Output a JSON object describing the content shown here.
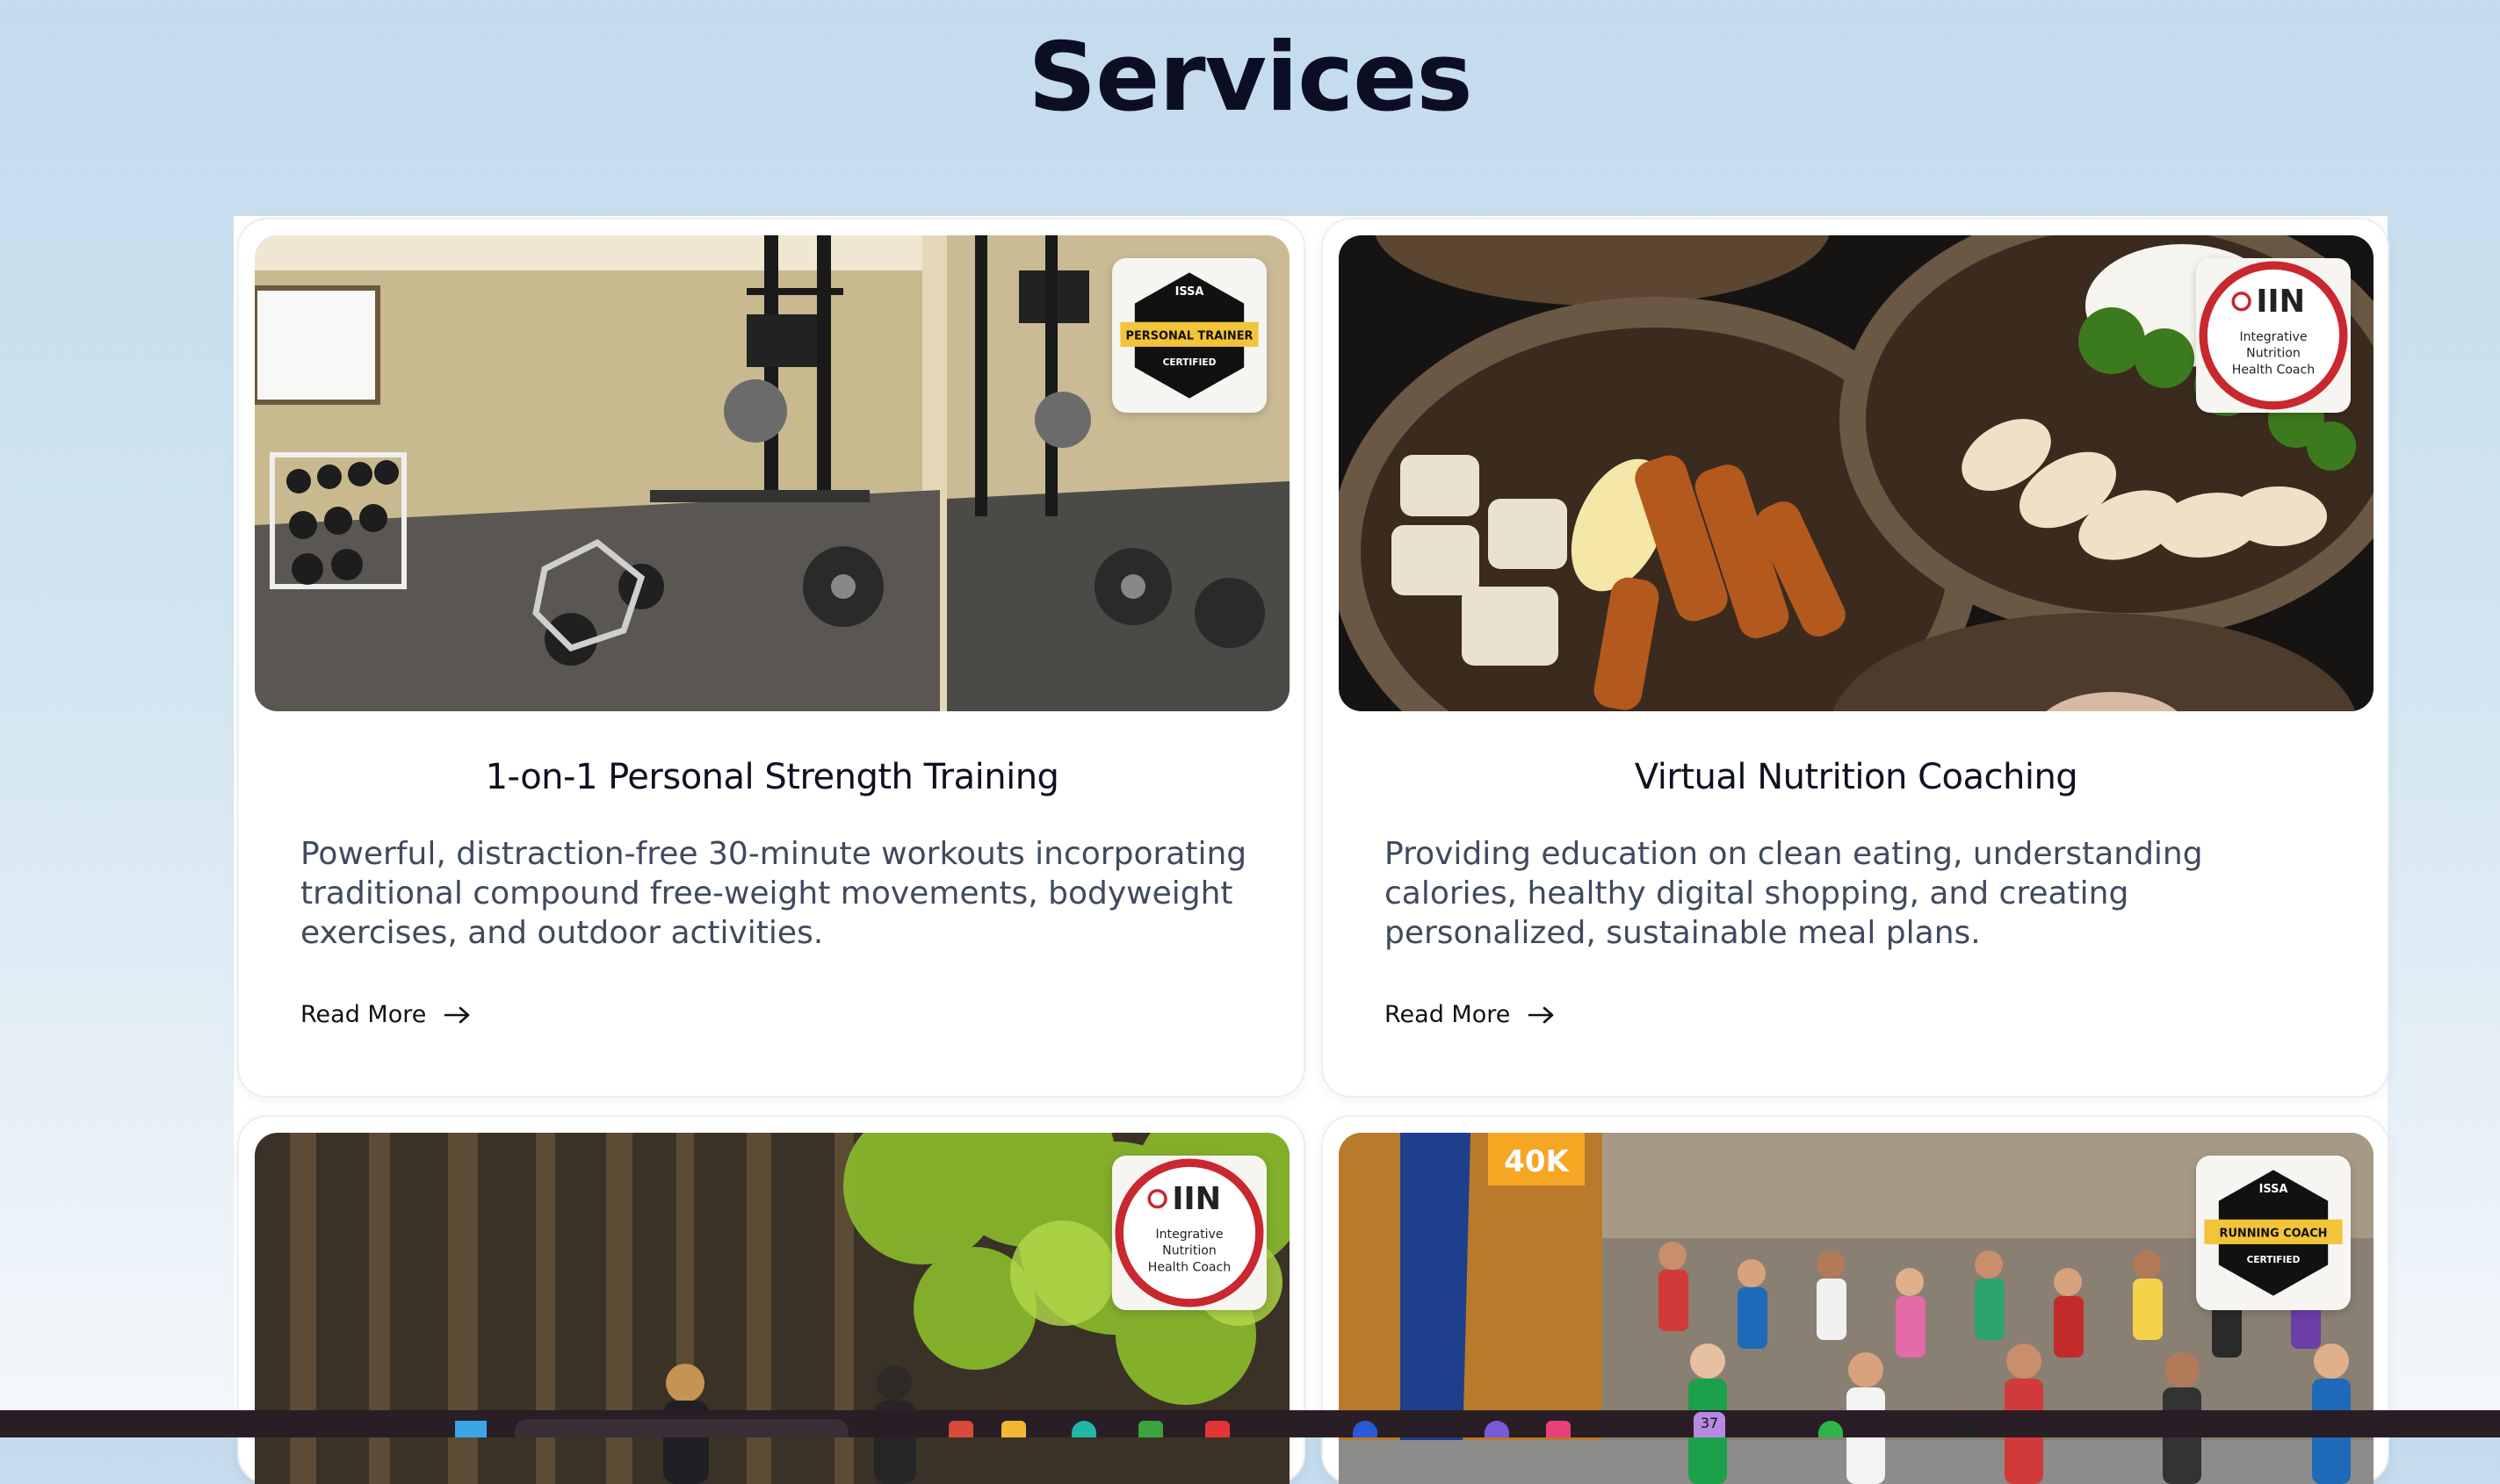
{
  "page": {
    "title": "Services"
  },
  "cards": [
    {
      "title": "1-on-1 Personal Strength Training",
      "description": "Powerful, distraction-free 30-minute workouts incorporating traditional compound free-weight movements, bodyweight exercises, and outdoor activities.",
      "read_more": "Read More",
      "image": "home-gym-photo",
      "badge": {
        "org": "ISSA",
        "label": "PERSONAL TRAINER",
        "sub": "CERTIFIED"
      }
    },
    {
      "title": "Virtual Nutrition Coaching",
      "description": "Providing education on clean eating, understanding calories, healthy digital shopping, and creating personalized, sustainable meal plans.",
      "read_more": "Read More",
      "image": "meal-bowls-photo",
      "badge": {
        "org": "IIN",
        "label": "Integrative Nutrition Health Coach"
      }
    },
    {
      "title": "",
      "description": "",
      "read_more": "",
      "image": "forest-trail-photo",
      "badge": {
        "org": "IIN",
        "label": "Integrative Nutrition Health Coach"
      }
    },
    {
      "title": "",
      "description": "",
      "read_more": "",
      "image": "marathon-runners-photo",
      "badge": {
        "org": "ISSA",
        "label": "RUNNING COACH",
        "sub": "CERTIFIED"
      }
    }
  ],
  "banner": {
    "text": "40K"
  },
  "taskbar": {
    "notification_count": "37"
  },
  "colors": {
    "background_top": "#c3dbec",
    "title": "#0c0f24",
    "badge_yellow": "#f2c43a",
    "iin_red": "#c8282e"
  }
}
